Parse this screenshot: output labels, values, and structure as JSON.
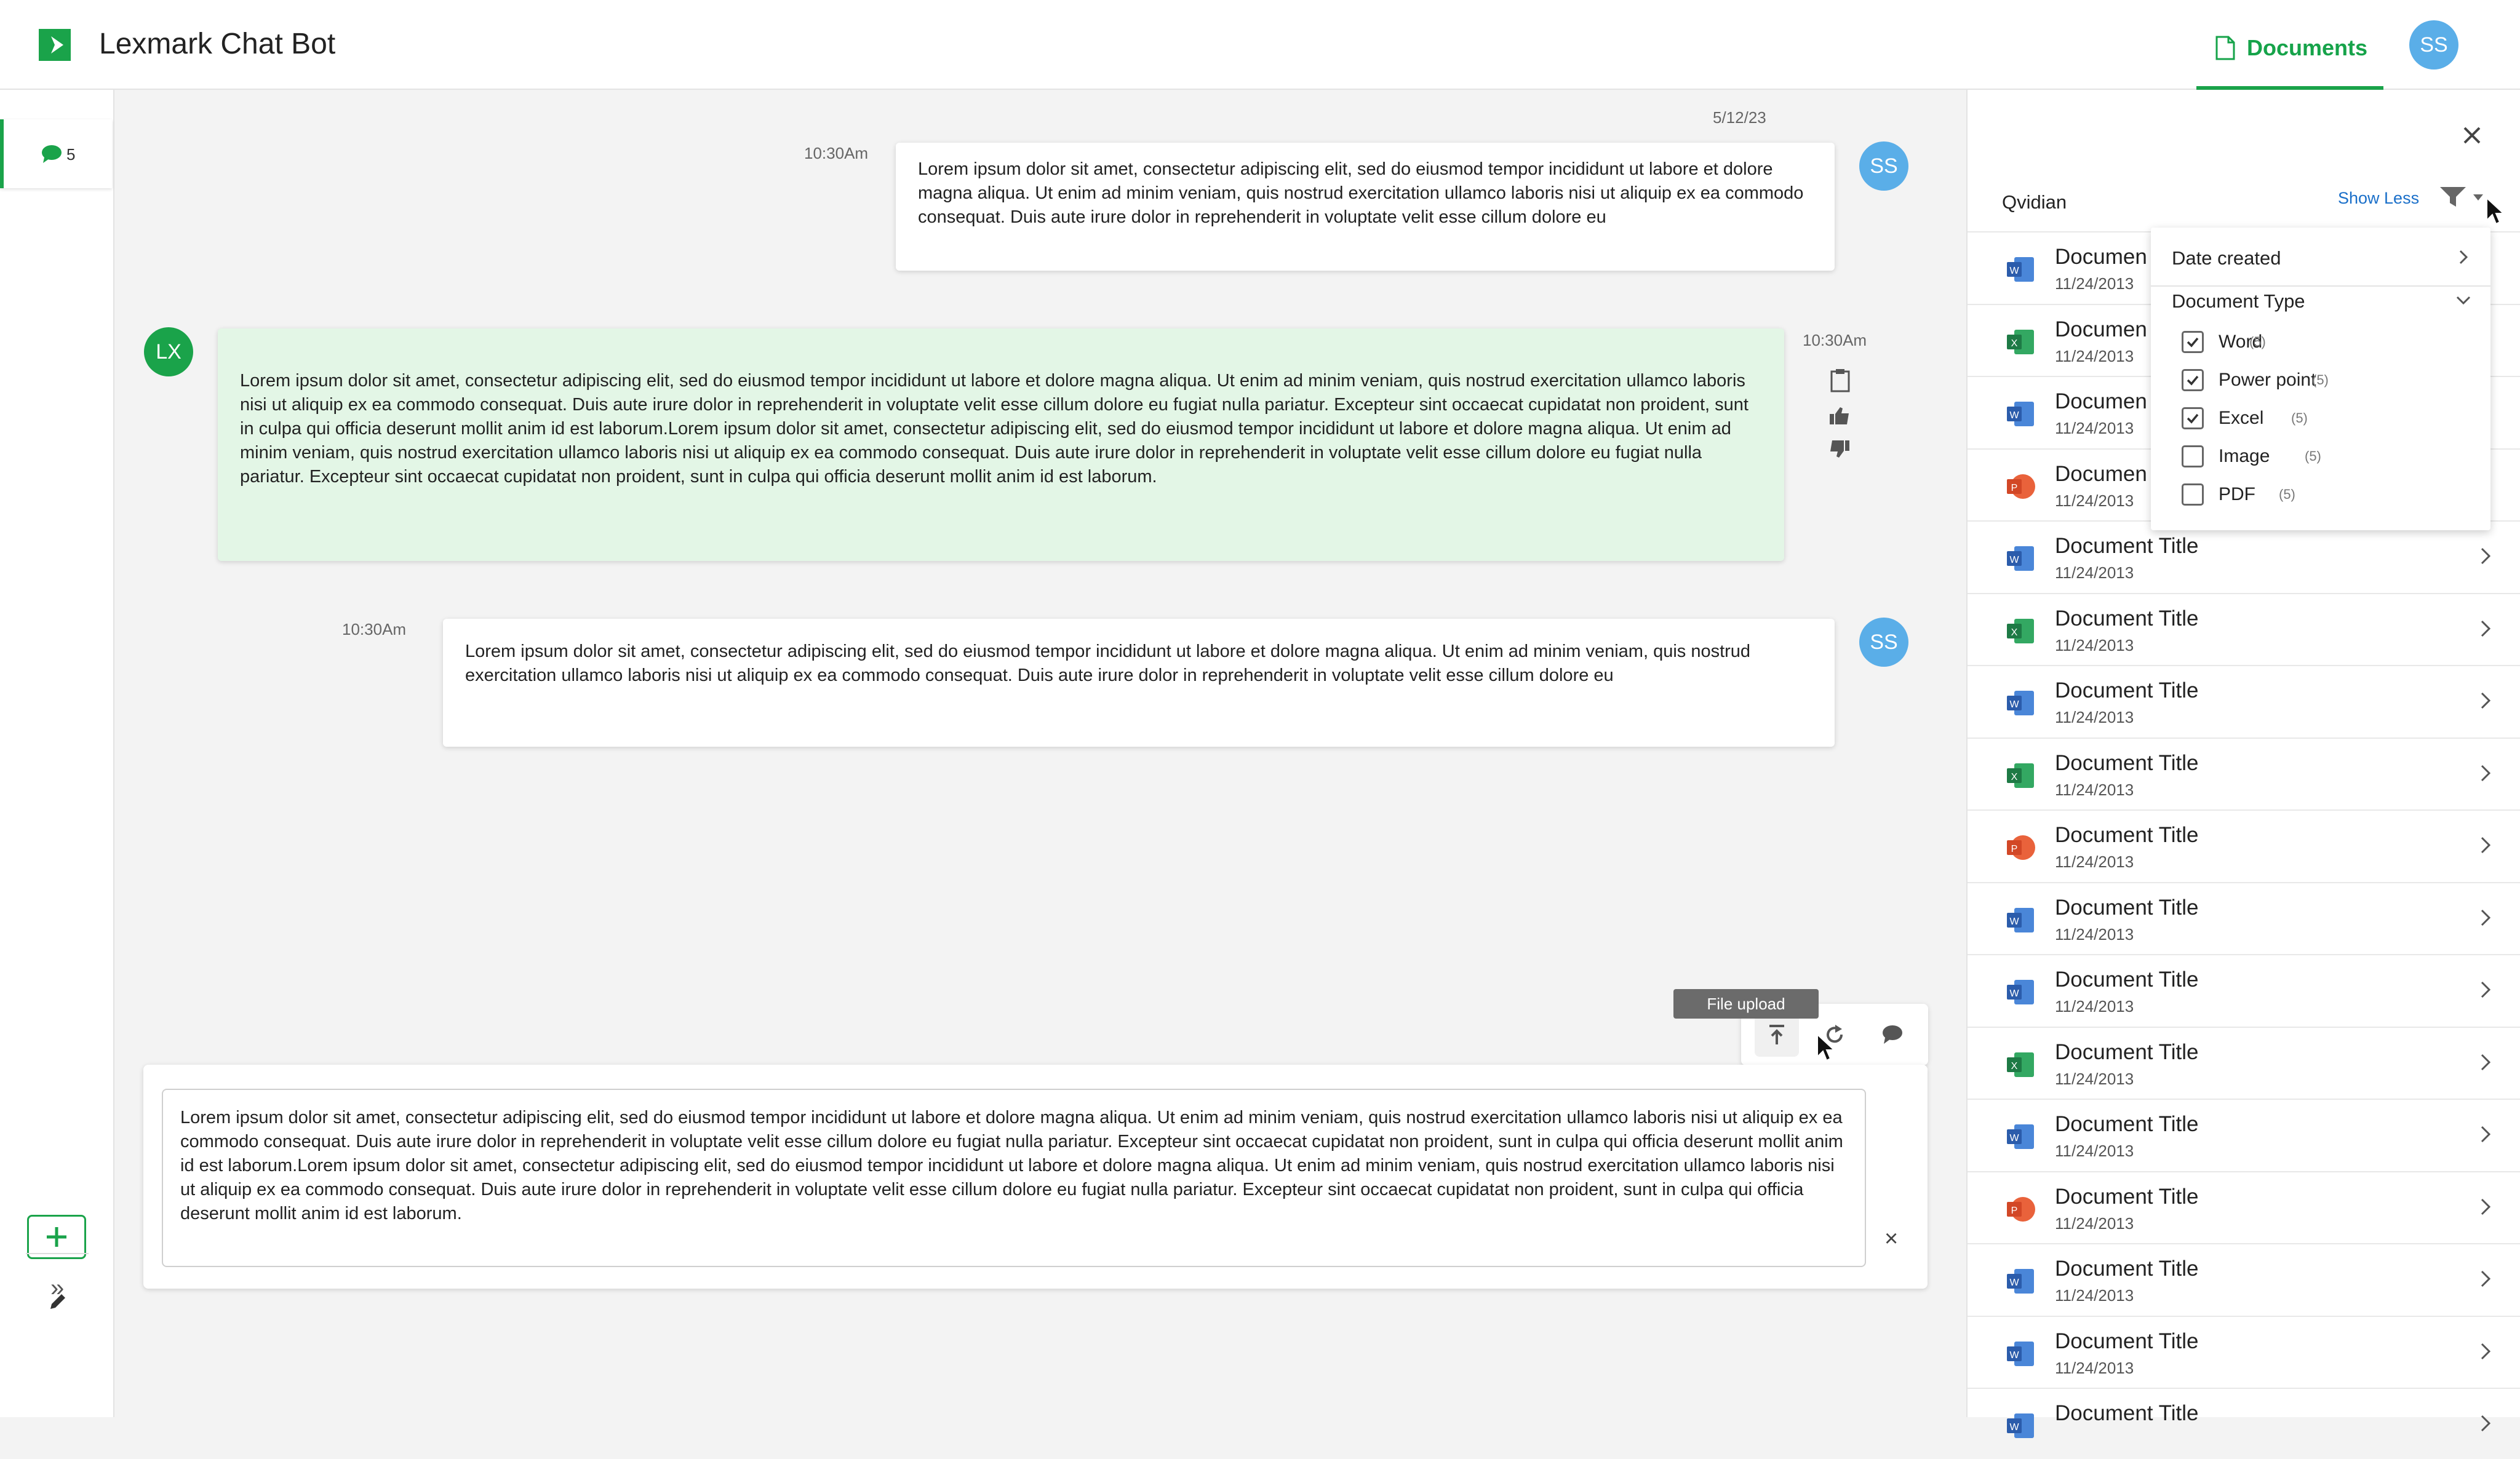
{
  "app": {
    "title": "Lexmark Chat Bot",
    "documents_tab": "Documents",
    "user_initials": "SS",
    "bot_initials": "LX"
  },
  "sidebar": {
    "chat_count": "5"
  },
  "chat": {
    "date": "5/12/23",
    "messages": [
      {
        "role": "user",
        "time": "10:30Am",
        "text": "Lorem ipsum dolor sit amet, consectetur adipiscing elit, sed do eiusmod tempor incididunt ut labore et dolore magna aliqua. Ut enim ad minim veniam, quis nostrud exercitation ullamco laboris nisi ut aliquip ex ea commodo consequat. Duis aute irure dolor in reprehenderit in voluptate velit esse cillum dolore eu"
      },
      {
        "role": "bot",
        "time": "10:30Am",
        "text": "Lorem ipsum dolor sit amet, consectetur adipiscing elit, sed do eiusmod tempor incididunt ut labore et dolore magna aliqua. Ut enim ad minim veniam, quis nostrud exercitation ullamco laboris nisi ut aliquip ex ea commodo consequat. Duis aute irure dolor in reprehenderit in voluptate velit esse cillum dolore eu fugiat nulla pariatur. Excepteur sint occaecat cupidatat non proident, sunt in culpa qui officia deserunt mollit anim id est laborum.Lorem ipsum dolor sit amet, consectetur adipiscing elit, sed do eiusmod tempor incididunt ut labore et dolore magna aliqua. Ut enim ad minim veniam, quis nostrud exercitation ullamco laboris nisi ut aliquip ex ea commodo consequat. Duis aute irure dolor in reprehenderit in voluptate velit esse cillum dolore eu fugiat nulla pariatur. Excepteur sint occaecat cupidatat non proident, sunt in culpa qui officia deserunt mollit anim id est laborum."
      },
      {
        "role": "user",
        "time": "10:30Am",
        "text": "Lorem ipsum dolor sit amet, consectetur adipiscing elit, sed do eiusmod tempor incididunt ut labore et dolore magna aliqua. Ut enim ad minim veniam, quis nostrud exercitation ullamco laboris nisi ut aliquip ex ea commodo consequat. Duis aute irure dolor in reprehenderit in voluptate velit esse cillum dolore eu"
      }
    ]
  },
  "composer": {
    "tooltip": "File upload",
    "text": "Lorem ipsum dolor sit amet, consectetur adipiscing elit, sed do eiusmod tempor incididunt ut labore et dolore magna aliqua. Ut enim ad minim veniam, quis nostrud exercitation ullamco laboris nisi ut aliquip ex ea commodo consequat. Duis aute irure dolor in reprehenderit in voluptate velit esse cillum dolore eu fugiat nulla pariatur. Excepteur sint occaecat cupidatat non proident, sunt in culpa qui officia deserunt mollit anim id est laborum.Lorem ipsum dolor sit amet, consectetur adipiscing elit, sed do eiusmod tempor incididunt ut labore et dolore magna aliqua. Ut enim ad minim veniam, quis nostrud exercitation ullamco laboris nisi ut aliquip ex ea commodo consequat. Duis aute irure dolor in reprehenderit in voluptate velit esse cillum dolore eu fugiat nulla pariatur. Excepteur sint occaecat cupidatat non proident, sunt in culpa qui officia deserunt mollit anim id est laborum."
  },
  "panel": {
    "title": "Qvidian",
    "show_less": "Show Less",
    "documents": [
      {
        "title": "Documen",
        "date": "11/24/2013",
        "type": "word"
      },
      {
        "title": "Documen",
        "date": "11/24/2013",
        "type": "excel"
      },
      {
        "title": "Documen",
        "date": "11/24/2013",
        "type": "word"
      },
      {
        "title": "Documen",
        "date": "11/24/2013",
        "type": "powerpoint"
      },
      {
        "title": "Document Title",
        "date": "11/24/2013",
        "type": "word"
      },
      {
        "title": "Document Title",
        "date": "11/24/2013",
        "type": "excel"
      },
      {
        "title": "Document Title",
        "date": "11/24/2013",
        "type": "word"
      },
      {
        "title": "Document Title",
        "date": "11/24/2013",
        "type": "excel"
      },
      {
        "title": "Document Title",
        "date": "11/24/2013",
        "type": "powerpoint"
      },
      {
        "title": "Document Title",
        "date": "11/24/2013",
        "type": "word"
      },
      {
        "title": "Document Title",
        "date": "11/24/2013",
        "type": "word"
      },
      {
        "title": "Document Title",
        "date": "11/24/2013",
        "type": "excel"
      },
      {
        "title": "Document Title",
        "date": "11/24/2013",
        "type": "word"
      },
      {
        "title": "Document Title",
        "date": "11/24/2013",
        "type": "powerpoint"
      },
      {
        "title": "Document Title",
        "date": "11/24/2013",
        "type": "word"
      },
      {
        "title": "Document Title",
        "date": "11/24/2013",
        "type": "word"
      },
      {
        "title": "Document Title",
        "date": "",
        "type": "word"
      }
    ],
    "filter": {
      "date_created": "Date created",
      "document_type": "Document Type",
      "options": [
        {
          "label": "Word",
          "count": "(5)",
          "checked": true
        },
        {
          "label": "Power point",
          "count": "(5)",
          "checked": true
        },
        {
          "label": "Excel",
          "count": "(5)",
          "checked": true
        },
        {
          "label": "Image",
          "count": "(5)",
          "checked": false
        },
        {
          "label": "PDF",
          "count": "(5)",
          "checked": false
        }
      ]
    }
  },
  "colors": {
    "accent": "#1aa34a",
    "avatar_user": "#5aaee8",
    "bot_bubble": "#e3f6e6",
    "link": "#1a6fc9",
    "word": "#2b5cab",
    "excel": "#1e7a45",
    "powerpoint": "#d24726"
  }
}
